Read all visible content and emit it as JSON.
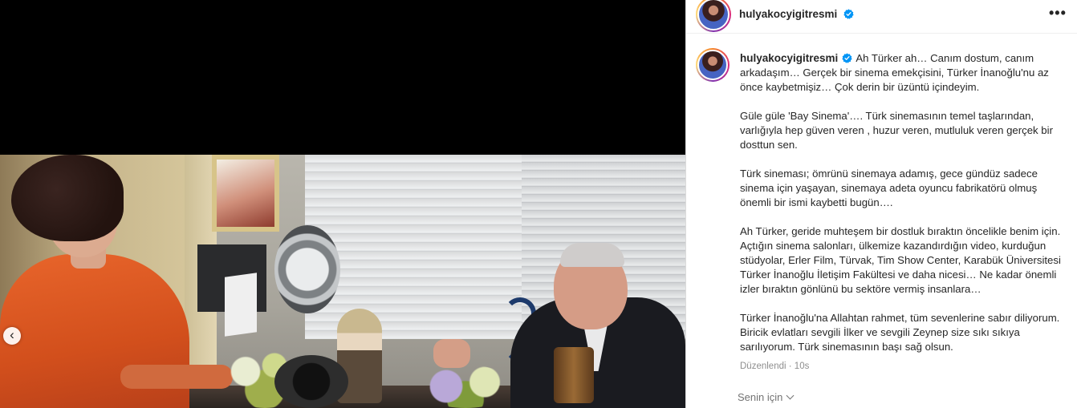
{
  "post": {
    "username": "hulyakocyigitresmi",
    "more_icon": "•••",
    "carousel_prev_icon": "‹",
    "caption_paragraphs": [
      "Ah Türker ah… Canım dostum, canım arkadaşım… Gerçek bir sinema emekçisini, Türker İnanoğlu'nu az önce kaybetmişiz… Çok derin bir üzüntü içindeyim.",
      "Güle güle 'Bay Sinema'…. Türk sinemasının temel taşlarından, varlığıyla hep güven veren , huzur veren, mutluluk veren gerçek bir dosttun sen.",
      "Türk sineması; ömrünü sinemaya adamış, gece gündüz sadece sinema için yaşayan, sinemaya adeta oyuncu fabrikatörü olmuş önemli bir ismi kaybetti bugün….",
      "Ah Türker, geride muhteşem bir dostluk bıraktın öncelikle benim için. Açtığın sinema salonları, ülkemize kazandırdığın video, kurduğun stüdyolar, Erler Film, Türvak, Tim Show Center, Karabük Üniversitesi Türker İnanoğlu İletişim Fakültesi ve daha nicesi… Ne kadar önemli izler bıraktın gönlünü bu sektöre vermiş insanlara…",
      "Türker İnanoğlu'na Allahtan rahmet, tüm sevenlerine sabır diliyorum. Biricik evlatları sevgili İlker ve sevgili Zeynep size sıkı sıkıya sarılıyorum. Türk sinemasının başı sağ olsun."
    ],
    "edited_label": "Düzenlendi",
    "time_ago": "10s",
    "for_you_label": "Senin için"
  },
  "colors": {
    "verified_badge": "#0095f6",
    "muted_text": "#8e8e8e"
  }
}
